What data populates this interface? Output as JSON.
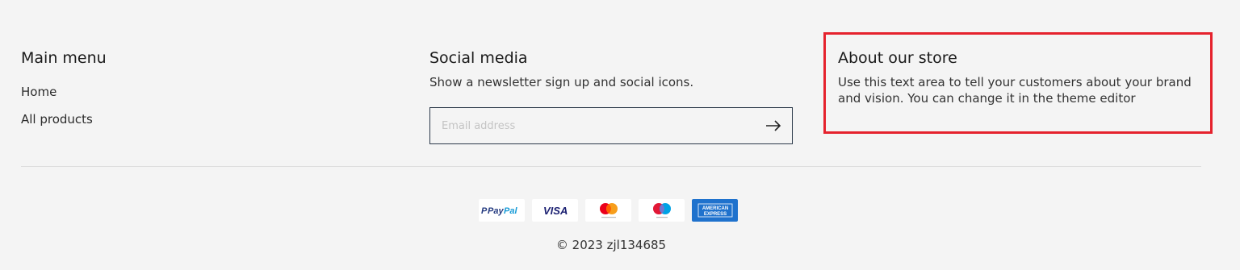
{
  "main_menu": {
    "heading": "Main menu",
    "links": [
      "Home",
      "All products"
    ]
  },
  "social": {
    "heading": "Social media",
    "description": "Show a newsletter sign up and social icons.",
    "email_placeholder": "Email address",
    "submit_icon": "arrow-right-icon"
  },
  "about": {
    "heading": "About our store",
    "description": "Use this text area to tell your customers about your brand and vision. You can change it in the theme editor",
    "highlight_color": "#e5222d"
  },
  "payment_methods": [
    "PayPal",
    "Visa",
    "Mastercard",
    "Maestro",
    "American Express"
  ],
  "copyright": "© 2023 zjl134685"
}
